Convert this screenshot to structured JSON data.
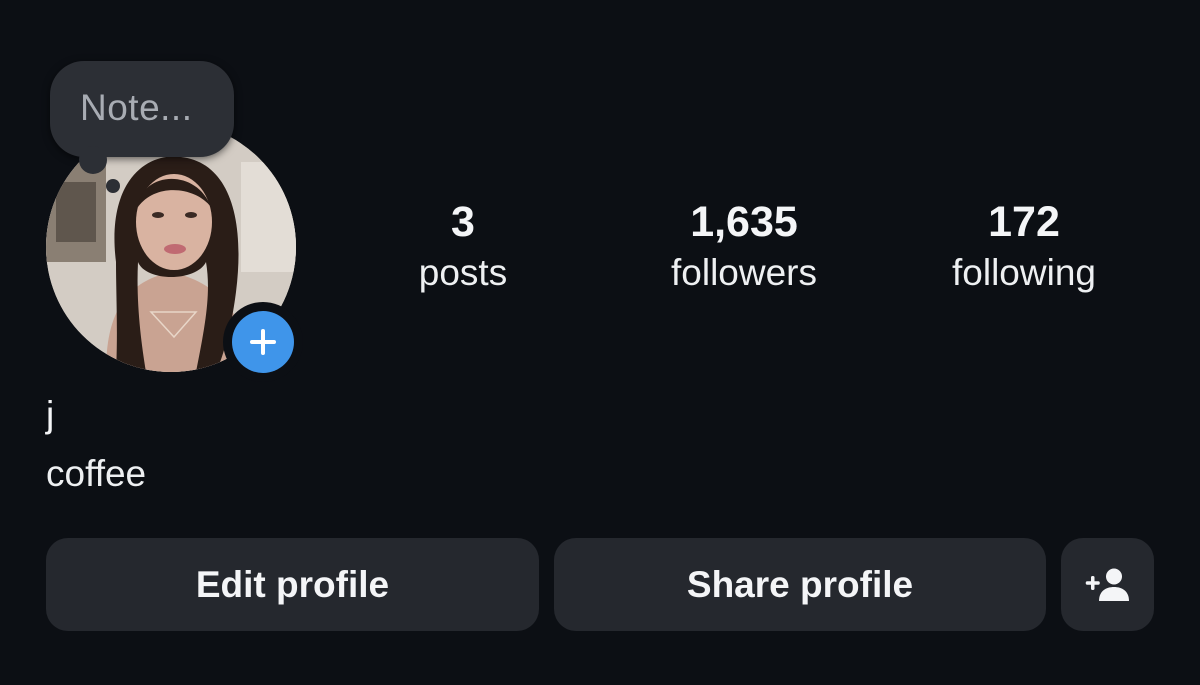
{
  "note": {
    "placeholder": "Note..."
  },
  "avatar": {
    "alt": "profile photo"
  },
  "stats": {
    "posts": {
      "count": "3",
      "label": "posts"
    },
    "followers": {
      "count": "1,635",
      "label": "followers"
    },
    "following": {
      "count": "172",
      "label": "following"
    }
  },
  "profile": {
    "name": "j",
    "bio": "coffee"
  },
  "actions": {
    "edit_label": "Edit profile",
    "share_label": "Share profile",
    "discover_icon": "add-person-icon"
  },
  "colors": {
    "background": "#0c0f14",
    "button": "#25282e",
    "accent": "#3f95ea"
  }
}
